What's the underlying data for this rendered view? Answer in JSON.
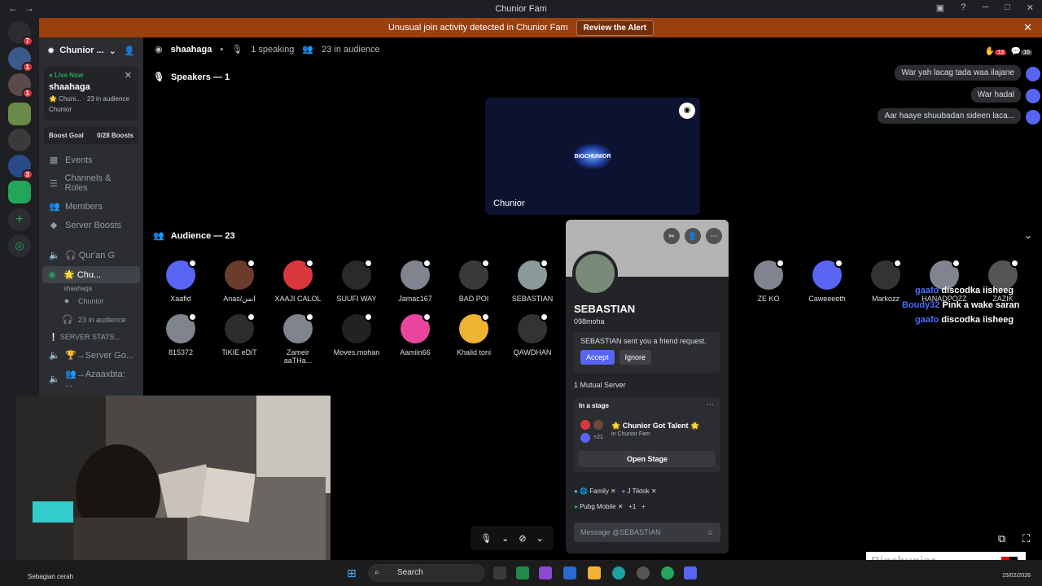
{
  "window": {
    "title": "Chunior Fam"
  },
  "alert": {
    "text": "Unusual join activity detected in Chunior Fam",
    "action": "Review the Alert"
  },
  "rail": {
    "badges": [
      "7",
      "1",
      "1",
      "3"
    ]
  },
  "sidebar": {
    "server_name": "Chunior ...",
    "live": {
      "label": "Live Now",
      "name": "shaahaga",
      "sub": "🌟 Chuni... · 23 in audience",
      "host": "Chunior"
    },
    "boost": {
      "label": "Boost Goal",
      "value": "0/28 Boosts"
    },
    "items": [
      "Events",
      "Channels & Roles",
      "Members",
      "Server Boosts"
    ],
    "channels": [
      {
        "label": "🎧 Qur'an G"
      },
      {
        "label": "🌟 Chu..."
      },
      {
        "label": "shaahaga"
      },
      {
        "label": "Chunior"
      },
      {
        "label": "23 in audience"
      },
      {
        "label": "❕ SERVER STATS..."
      },
      {
        "label": "🏆→Server Go..."
      },
      {
        "label": "👥→Azaaxbta: ..."
      }
    ]
  },
  "stage": {
    "channel": "shaahaga",
    "speaking": "1 speaking",
    "audience_count": "23 in audience",
    "speakers_header": "Speakers — 1",
    "speaker_name": "Chunior",
    "speaker_logo": "BIGCHUNIOR",
    "audience_header": "Audience — 23",
    "rail_badges": [
      "13",
      "16"
    ]
  },
  "audience": [
    {
      "name": "Xaafid",
      "color": "#5865f2"
    },
    {
      "name": "Anas/انس",
      "color": "#6b3c2a"
    },
    {
      "name": "XAAJI CALOL",
      "color": "#da373c"
    },
    {
      "name": "SUUFI WAY",
      "color": "#2a2a2a"
    },
    {
      "name": "Jamac167",
      "color": "#80848e"
    },
    {
      "name": "BAD POI",
      "color": "#3a3a3a"
    },
    {
      "name": "SEBASTIAN",
      "color": "#8a9a9a"
    },
    {
      "name": "ZE KO",
      "color": "#80848e"
    },
    {
      "name": "Caweeeeth",
      "color": "#5865f2"
    },
    {
      "name": "Markozz",
      "color": "#333333"
    },
    {
      "name": "HANADPOZZ",
      "color": "#80848e"
    },
    {
      "name": "ZAZIK",
      "color": "#555555"
    },
    {
      "name": "815372",
      "color": "#80848e"
    },
    {
      "name": "TiKIE eDiT",
      "color": "#2c2c2c"
    },
    {
      "name": "Zameir aaTHa...",
      "color": "#80848e"
    },
    {
      "name": "Moves.mohan",
      "color": "#222222"
    },
    {
      "name": "Aamiin66",
      "color": "#eb459e"
    },
    {
      "name": "Khalid toni",
      "color": "#f0b232"
    },
    {
      "name": "QAWDHAN",
      "color": "#333333"
    }
  ],
  "chat": [
    "War yah lacag tada waa ilajane",
    "War hadal",
    "Aar haaye shuubadan sideen laca..."
  ],
  "overlay_chat": [
    {
      "user": "gaafo",
      "msg": "discodka iisheeg"
    },
    {
      "user": "Boudy32",
      "msg": "Pink a wake saran"
    },
    {
      "user": "gaafo",
      "msg": "discodka iisheeg"
    }
  ],
  "profile": {
    "name": "SEBASTIAN",
    "username": "098moha",
    "request_text": "SEBASTIAN sent you a friend request.",
    "accept": "Accept",
    "ignore": "Ignore",
    "mutual": "1 Mutual Server",
    "stage_label": "In a stage",
    "stage_title": "🌟 Chunior Got Talent 🌟",
    "stage_sub": "in Chunior Fam",
    "stage_count": "+21",
    "open_stage": "Open Stage",
    "tags": [
      "🌐 Family",
      "J Tiktok",
      "Pubg Mobile",
      "+1"
    ],
    "message_placeholder": "Message @SEBASTIAN"
  },
  "taskbar": {
    "search": "Search",
    "weather": "Sebagian cerah",
    "date": "15/02/2026"
  },
  "watermark": "Bigchunior"
}
